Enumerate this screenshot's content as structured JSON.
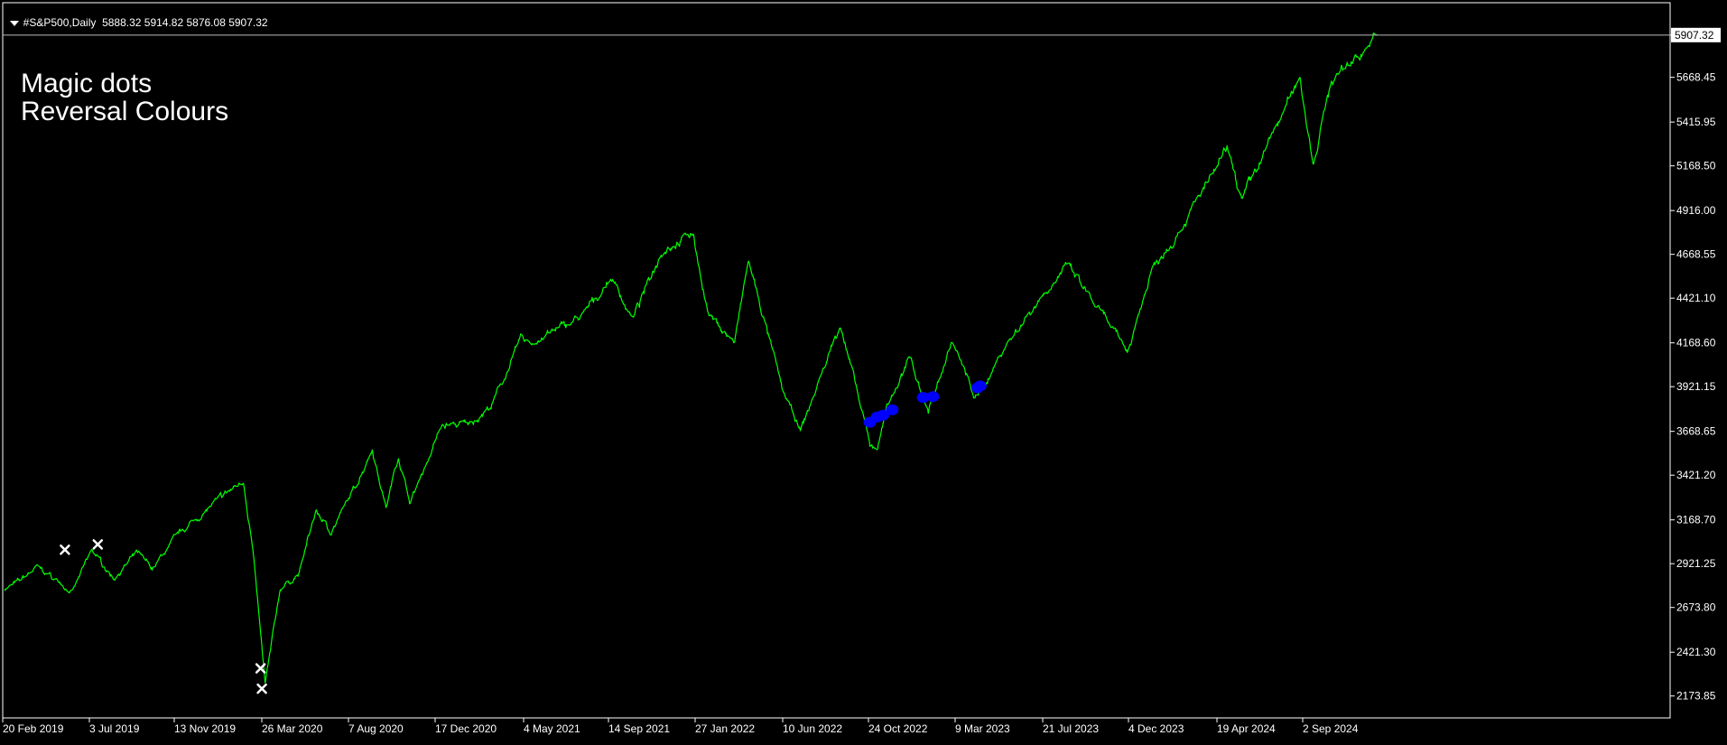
{
  "header": {
    "symbol": "#S&P500,Daily",
    "ohlc": "5888.32 5914.82 5876.08 5907.32"
  },
  "indicator": {
    "line1": "Magic dots",
    "line2": "Reversal Colours"
  },
  "colors": {
    "background": "#000000",
    "price_line": "#00ff00",
    "axis": "#ffffff",
    "buy_dot": "#0000ff",
    "sell_marker": "#ffffff"
  },
  "chart_data": {
    "type": "line",
    "series": [
      {
        "values_are": "daily close (approx.)",
        "x": [
          "2019-02-20",
          "2019-03-15",
          "2019-04-10",
          "2019-05-06",
          "2019-06-03",
          "2019-07-03",
          "2019-08-05",
          "2019-09-10",
          "2019-10-03",
          "2019-11-13",
          "2020-01-10",
          "2020-02-19",
          "2020-03-04",
          "2020-03-23",
          "2020-04-15",
          "2020-05-13",
          "2020-06-08",
          "2020-07-01",
          "2020-08-07",
          "2020-09-02",
          "2020-09-23",
          "2020-10-12",
          "2020-10-30",
          "2020-12-17",
          "2021-01-29",
          "2021-03-04",
          "2021-04-16",
          "2021-05-04",
          "2021-06-15",
          "2021-07-20",
          "2021-09-02",
          "2021-10-04",
          "2021-11-18",
          "2022-01-03",
          "2022-01-27",
          "2022-03-08",
          "2022-03-29",
          "2022-05-20",
          "2022-06-16",
          "2022-08-16",
          "2022-09-30",
          "2022-10-12",
          "2022-10-24",
          "2022-12-01",
          "2022-12-28",
          "2023-02-02",
          "2023-03-09",
          "2023-03-13",
          "2023-04-20",
          "2023-06-15",
          "2023-07-21",
          "2023-07-31",
          "2023-10-27",
          "2023-12-04",
          "2024-01-19",
          "2024-03-28",
          "2024-04-19",
          "2024-06-05",
          "2024-07-16",
          "2024-08-05",
          "2024-09-02",
          "2024-11-11"
        ],
        "y": [
          2780,
          2820,
          2900,
          2840,
          2760,
          2995,
          2840,
          2980,
          2890,
          3090,
          3275,
          3390,
          3010,
          2237,
          2780,
          2860,
          3220,
          3100,
          3350,
          3580,
          3240,
          3530,
          3270,
          3700,
          3710,
          3820,
          4185,
          4170,
          4250,
          4320,
          4540,
          4300,
          4700,
          4790,
          4330,
          4170,
          4630,
          3900,
          3665,
          4280,
          3585,
          3577,
          3800,
          4080,
          3780,
          4180,
          3860,
          3855,
          4130,
          4420,
          4580,
          4590,
          4120,
          4590,
          4840,
          5250,
          4970,
          5350,
          5670,
          5190,
          5650,
          5907
        ]
      }
    ],
    "buy_dots": [
      {
        "x": "2022-09-30",
        "y": 3720
      },
      {
        "x": "2022-10-11",
        "y": 3750
      },
      {
        "x": "2022-10-20",
        "y": 3760
      },
      {
        "x": "2022-11-03",
        "y": 3790
      },
      {
        "x": "2022-12-20",
        "y": 3860
      },
      {
        "x": "2023-01-04",
        "y": 3865
      },
      {
        "x": "2023-03-13",
        "y": 3915
      },
      {
        "x": "2023-03-17",
        "y": 3925
      }
    ],
    "sell_markers": [
      {
        "x": "2019-05-23",
        "y": 3000
      },
      {
        "x": "2019-07-12",
        "y": 3030
      },
      {
        "x": "2020-03-16",
        "y": 2330
      },
      {
        "x": "2020-03-18",
        "y": 2215
      }
    ],
    "last_price": 5907.32,
    "ylim": [
      2050,
      6090
    ],
    "yticks": [
      "5907.32",
      "5668.45",
      "5415.95",
      "5168.50",
      "4916.00",
      "4668.55",
      "4421.10",
      "4168.60",
      "3921.15",
      "3668.65",
      "3421.20",
      "3168.70",
      "2921.25",
      "2673.80",
      "2421.30",
      "2173.85"
    ],
    "xticks": [
      "20 Feb 2019",
      "3 Jul 2019",
      "13 Nov 2019",
      "26 Mar 2020",
      "7 Aug 2020",
      "17 Dec 2020",
      "4 May 2021",
      "14 Sep 2021",
      "27 Jan 2022",
      "10 Jun 2022",
      "24 Oct 2022",
      "9 Mar 2023",
      "21 Jul 2023",
      "4 Dec 2023",
      "19 Apr 2024",
      "2 Sep 2024"
    ],
    "x_start": "2019-02-20",
    "x_end": "2026-01-28",
    "grid": false,
    "legend": "none"
  }
}
